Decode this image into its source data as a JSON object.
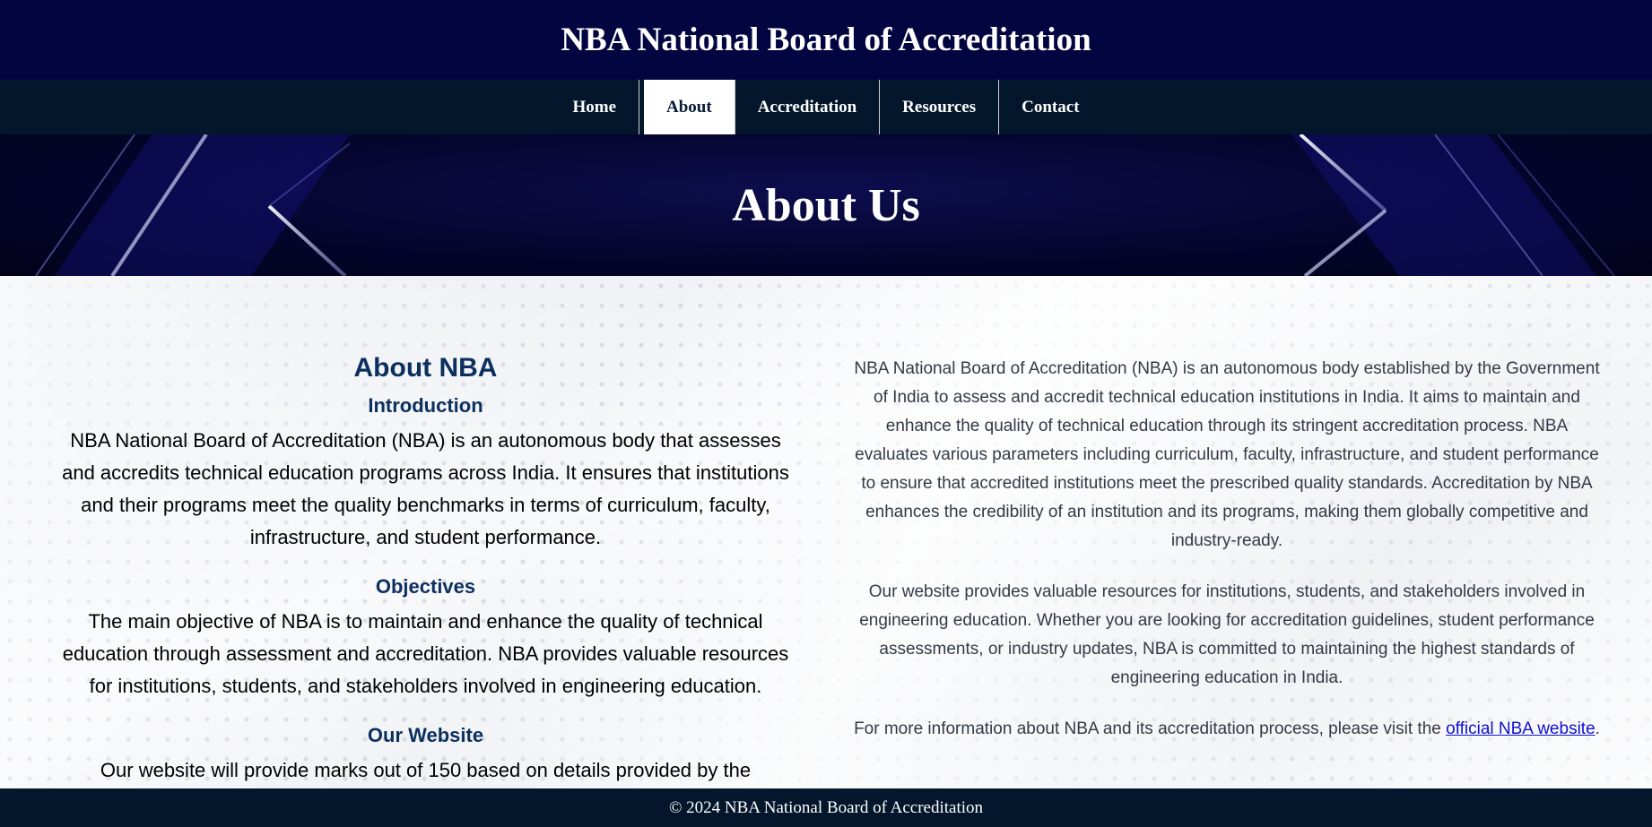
{
  "header": {
    "title": "NBA National Board of Accreditation"
  },
  "nav": {
    "items": [
      {
        "label": "Home"
      },
      {
        "label": "About"
      },
      {
        "label": "Accreditation"
      },
      {
        "label": "Resources"
      },
      {
        "label": "Contact"
      }
    ],
    "active": "About"
  },
  "hero": {
    "title": "About Us"
  },
  "left": {
    "heading": "About NBA",
    "sections": [
      {
        "title": "Introduction",
        "text": "NBA National Board of Accreditation (NBA) is an autonomous body that assesses and accredits technical education programs across India. It ensures that institutions and their programs meet the quality benchmarks in terms of curriculum, faculty, infrastructure, and student performance."
      },
      {
        "title": "Objectives",
        "text": "The main objective of NBA is to maintain and enhance the quality of technical education through assessment and accreditation. NBA provides valuable resources for institutions, students, and stakeholders involved in engineering education."
      },
      {
        "title": "Our Website",
        "text": "Our website will provide marks out of 150 based on details provided by the"
      }
    ]
  },
  "right": {
    "paragraphs": [
      "NBA National Board of Accreditation (NBA) is an autonomous body established by the Government of India to assess and accredit technical education institutions in India. It aims to maintain and enhance the quality of technical education through its stringent accreditation process. NBA evaluates various parameters including curriculum, faculty, infrastructure, and student performance to ensure that accredited institutions meet the prescribed quality standards. Accreditation by NBA enhances the credibility of an institution and its programs, making them globally competitive and industry-ready.",
      "Our website provides valuable resources for institutions, students, and stakeholders involved in engineering education. Whether you are looking for accreditation guidelines, student performance assessments, or industry updates, NBA is committed to maintaining the highest standards of engineering education in India."
    ],
    "more_info_prefix": "For more information about NBA and its accreditation process, please visit the ",
    "more_info_link": "official NBA website",
    "more_info_suffix": "."
  },
  "footer": {
    "text": "© 2024 NBA National Board of Accreditation"
  },
  "colors": {
    "header_bg": "#030541",
    "nav_bg": "#03162b",
    "heading_blue": "#0b2f5e",
    "link": "#1010d0"
  }
}
